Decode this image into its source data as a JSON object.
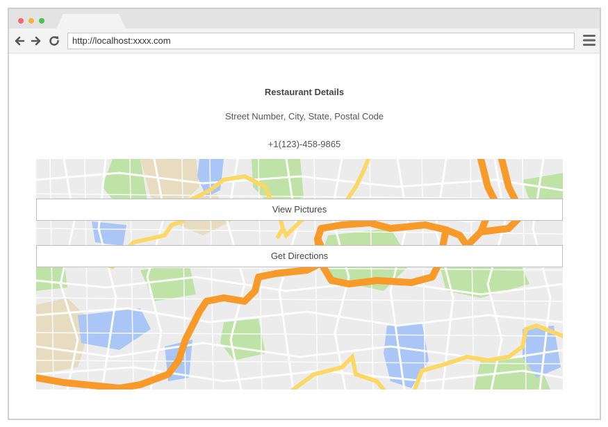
{
  "browser": {
    "url": "http://localhost:xxxx.com",
    "icons": {
      "back": "back-arrow-icon",
      "forward": "forward-arrow-icon",
      "reload": "reload-icon",
      "menu": "hamburger-menu-icon"
    }
  },
  "restaurant": {
    "title": "Restaurant Details",
    "address": "Street Number, City, State, Postal Code",
    "phone": "+1(123)-458-9865"
  },
  "actions": {
    "view_pictures": "View Pictures",
    "get_directions": "Get Directions"
  },
  "colors": {
    "map_background": "#ececec",
    "park": "#bfe3a6",
    "water": "#a9c6f7",
    "sand": "#e8dcc0",
    "highway": "#f79a2a",
    "major_road": "#fbd866",
    "street": "#ffffff"
  }
}
